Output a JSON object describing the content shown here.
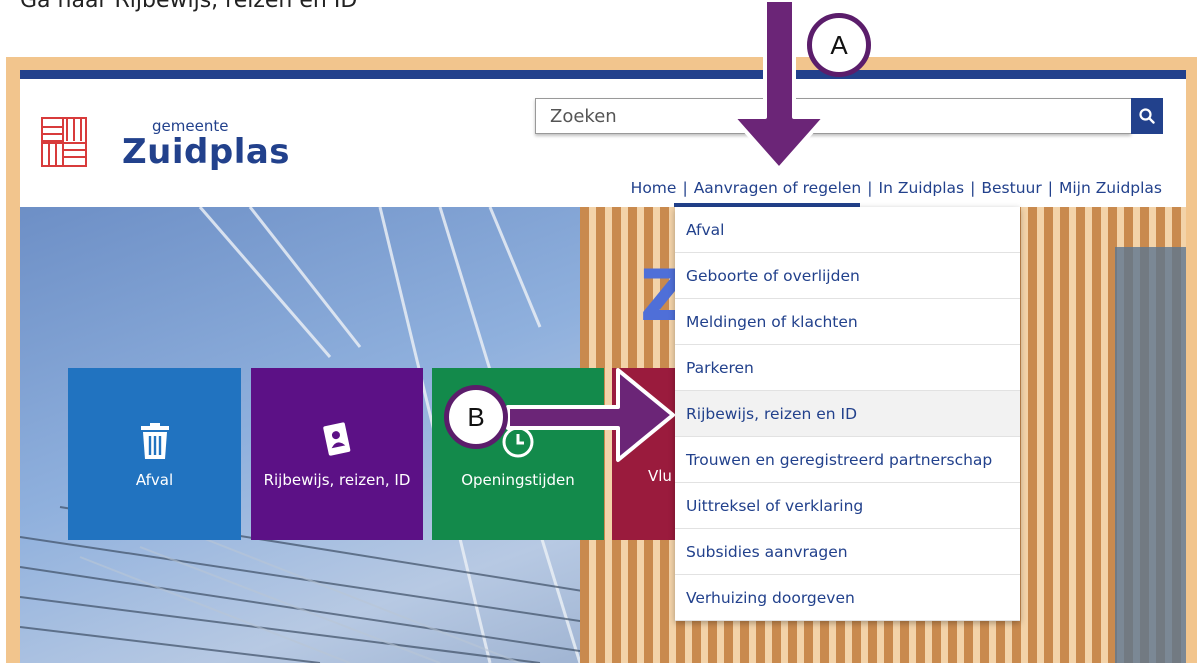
{
  "caption": "Ga naar Rijbewijs, reizen en ID",
  "logo": {
    "sub": "gemeente",
    "main": "Zuidplas"
  },
  "search": {
    "placeholder": "Zoeken"
  },
  "nav": [
    "Home",
    "Aanvragen of regelen",
    "In Zuidplas",
    "Bestuur",
    "Mijn Zuidplas"
  ],
  "dropdown": [
    "Afval",
    "Geboorte of overlijden",
    "Meldingen of klachten",
    "Parkeren",
    "Rijbewijs, reizen en ID",
    "Trouwen en geregistreerd partnerschap",
    "Uittreksel of verklaring",
    "Subsidies aanvragen",
    "Verhuizing doorgeven"
  ],
  "dropdown_highlighted": "Rijbewijs, reizen en ID",
  "tiles": [
    {
      "label": "Afval",
      "icon": "trash-icon",
      "color": "#2173c0"
    },
    {
      "label": "Rijbewijs, reizen, ID",
      "icon": "passport-icon",
      "color": "#5c1186"
    },
    {
      "label": "Openingstijden",
      "icon": "clock-icon",
      "color": "#138a4b"
    },
    {
      "label": "Vlu",
      "icon": "",
      "color": "#9a1b3d"
    }
  ],
  "hero_sign": "Z",
  "callouts": {
    "a": "A",
    "b": "B"
  },
  "colors": {
    "brand": "#22418c",
    "arrow": "#6b2577",
    "frame": "#f2c58d",
    "logo_red": "#d83b3b"
  }
}
